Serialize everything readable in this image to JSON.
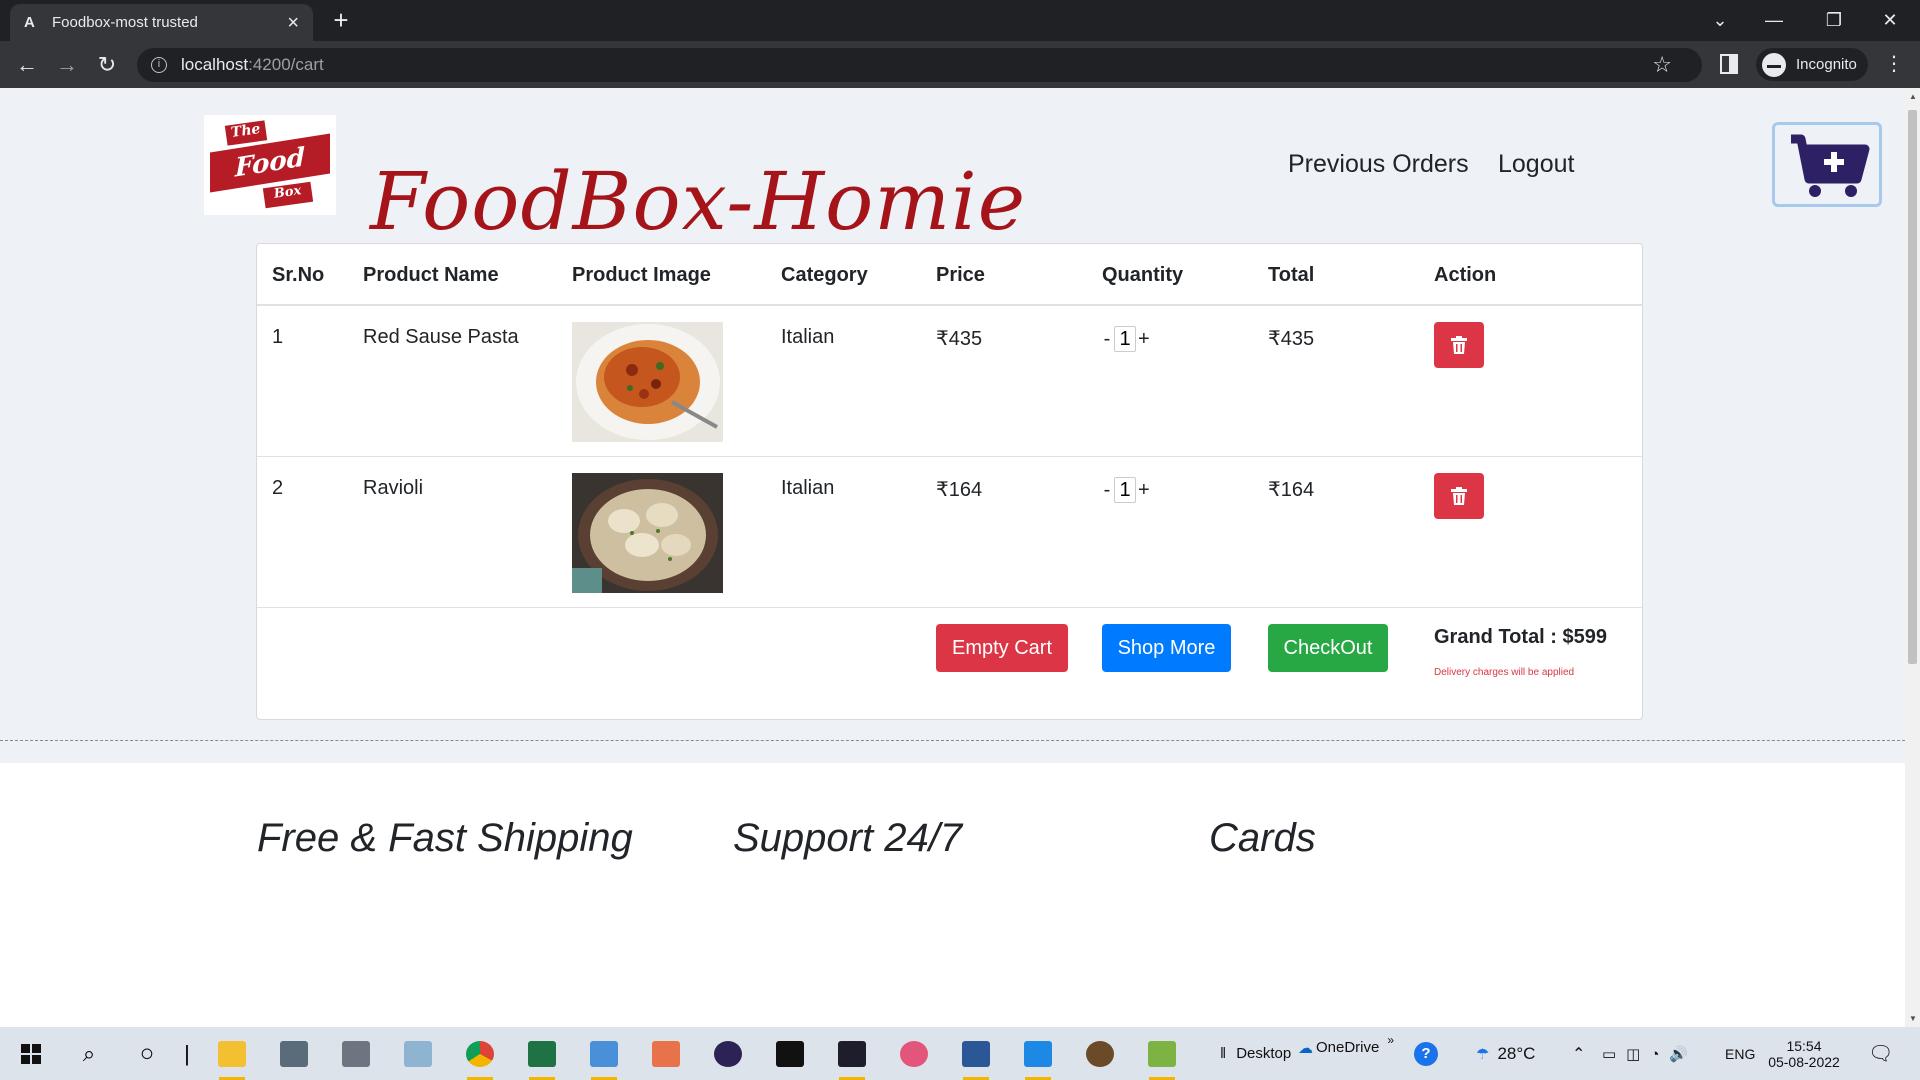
{
  "browser": {
    "tab_title": "Foodbox-most trusted",
    "tab_favicon": "A",
    "url_host": "localhost",
    "url_path": ":4200/cart",
    "profile_label": "Incognito"
  },
  "header": {
    "logo_text_the": "The",
    "logo_text_food": "Food",
    "logo_text_box": "Box",
    "brand": "FoodBox-Homie",
    "nav": {
      "previous_orders": "Previous Orders",
      "logout": "Logout"
    },
    "cart_icon": "cart-plus-icon"
  },
  "cart": {
    "columns": [
      "Sr.No",
      "Product Name",
      "Product Image",
      "Category",
      "Price",
      "Quantity",
      "Total",
      "Action"
    ],
    "items": [
      {
        "sr": "1",
        "name": "Red Sause Pasta",
        "image": "pasta-image",
        "category": "Italian",
        "price": "₹435",
        "qty_minus": "-",
        "qty": "1",
        "qty_plus": "+",
        "total": "₹435",
        "action_icon": "trash-icon"
      },
      {
        "sr": "2",
        "name": "Ravioli",
        "image": "ravioli-image",
        "category": "Italian",
        "price": "₹164",
        "qty_minus": "-",
        "qty": "1",
        "qty_plus": "+",
        "total": "₹164",
        "action_icon": "trash-icon"
      }
    ],
    "buttons": {
      "empty": "Empty Cart",
      "shop": "Shop More",
      "checkout": "CheckOut"
    },
    "grand_total": "Grand Total : $599",
    "delivery_note": "Delivery charges will be applied",
    "colors": {
      "danger": "#dc3545",
      "primary": "#007bff",
      "success": "#28a745",
      "brand": "#a41418"
    }
  },
  "features": [
    "Free & Fast Shipping",
    "Support 24/7",
    "Cards"
  ],
  "taskbar": {
    "desktop": "Desktop",
    "onedrive": "OneDrive",
    "chevron": "»",
    "weather": "28°C",
    "lang": "ENG",
    "time": "15:54",
    "date": "05-08-2022"
  }
}
